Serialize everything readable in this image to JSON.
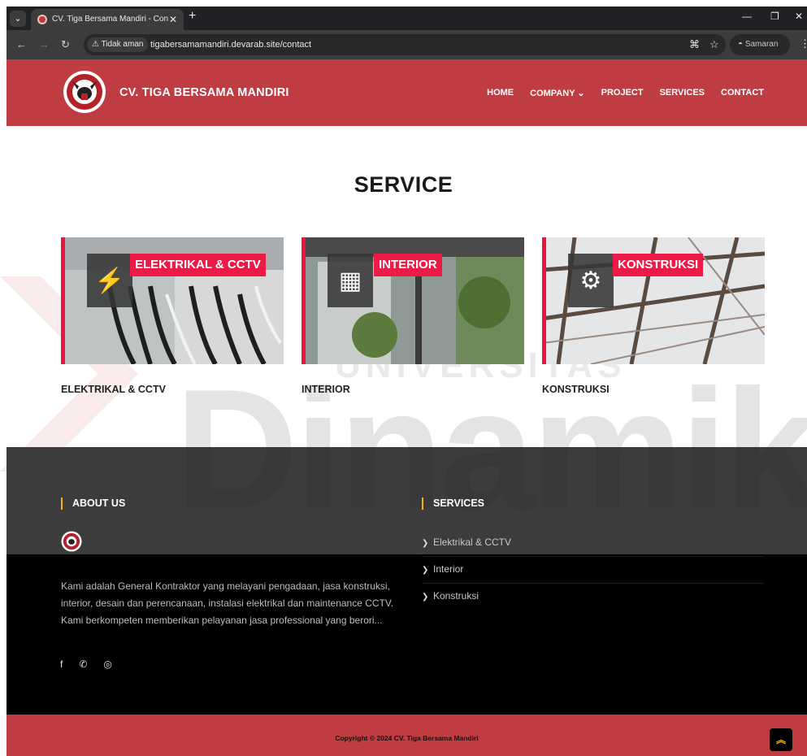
{
  "browser": {
    "tab_title": "CV. Tiga Bersama Mandiri - Con",
    "security_label": "Tidak aman",
    "url": "tigabersamamandiri.devarab.site/contact",
    "profile_label": "Samaran"
  },
  "header": {
    "brand": "CV. TIGA BERSAMA MANDIRI",
    "menu": [
      "HOME",
      "COMPANY",
      "PROJECT",
      "SERVICES",
      "CONTACT"
    ]
  },
  "main": {
    "title": "SERVICE",
    "cards": [
      {
        "badge": "ELEKTRIKAL & CCTV",
        "label": "ELEKTRIKAL & CCTV",
        "icon": "plug-icon"
      },
      {
        "badge": "INTERIOR",
        "label": "INTERIOR",
        "icon": "blueprint-icon"
      },
      {
        "badge": "KONSTRUKSI",
        "label": "KONSTRUKSI",
        "icon": "gears-icon"
      }
    ]
  },
  "watermark": {
    "top": "UNIVERSITAS",
    "main": "Dinamik"
  },
  "footer": {
    "about_heading": "ABOUT US",
    "about_text": "Kami adalah General Kontraktor yang melayani pengadaan, jasa konstruksi, interior, desain dan perencanaan, instalasi elektrikal dan maintenance CCTV. Kami berkompeten memberikan pelayanan jasa professional yang berori...",
    "services_heading": "SERVICES",
    "services": [
      "Elektrikal & CCTV",
      "Interior",
      "Konstruksi"
    ],
    "copyright": "Copyright © 2024 CV. Tiga Bersama Mandiri"
  },
  "colors": {
    "brand_red": "#bf3c42",
    "badge_pink": "#ec1a47",
    "accent_yellow": "#f4b400"
  }
}
